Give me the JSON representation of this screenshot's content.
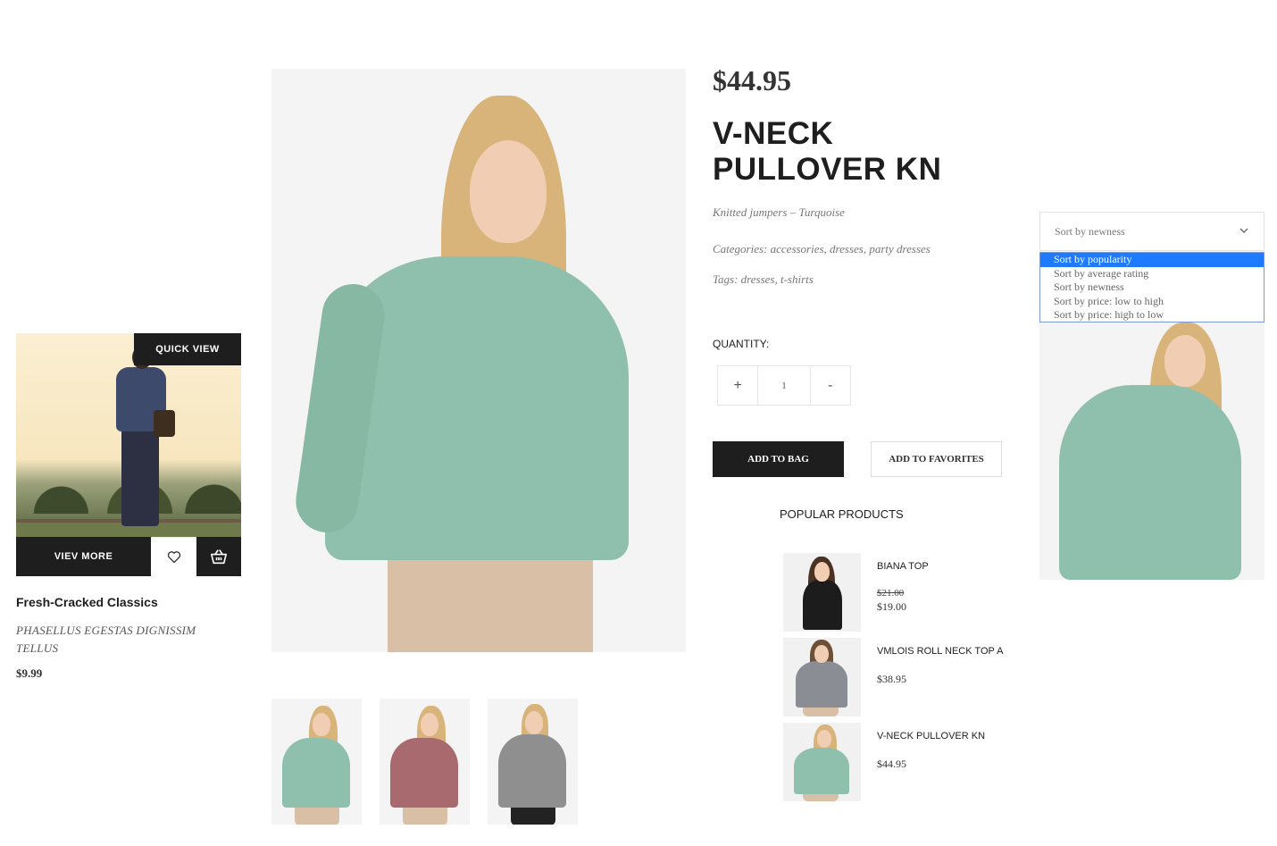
{
  "product_card": {
    "quick_view_label": "QUICK VIEW",
    "view_more_label": "VIEV MORE",
    "title": "Fresh-Cracked Classics",
    "subtitle": "PHASELLUS EGESTAS DIGNISSIM TELLUS",
    "price": "$9.99"
  },
  "product": {
    "price": "$44.95",
    "title": "V-NECK PULLOVER KN",
    "subtitle": "Knitted jumpers – Turquoise",
    "categories": "Categories: accessories, dresses, party dresses",
    "tags": "Tags: dresses, t-shirts",
    "quantity_label": "QUANTITY:",
    "quantity_plus": "+",
    "quantity_value": "1",
    "quantity_minus": "-",
    "add_to_bag_label": "ADD TO BAG",
    "add_to_favorites_label": "ADD TO FAVORITES",
    "thumbnail_colors": [
      "#8fc0ad",
      "#a86a6e",
      "#8f8f8f"
    ]
  },
  "popular": {
    "title": "POPULAR PRODUCTS",
    "items": [
      {
        "name": "BIANA TOP",
        "old_price": "$21.00",
        "price": "$19.00",
        "color": "#1c1c1c"
      },
      {
        "name": "VMLOIS ROLL NECK TOP A",
        "old_price": "",
        "price": "$38.95",
        "color": "#8a8d93"
      },
      {
        "name": "V-NECK PULLOVER KN",
        "old_price": "",
        "price": "$44.95",
        "color": "#8fc0ad"
      }
    ]
  },
  "sort": {
    "selected": "Sort by newness",
    "highlighted": "Sort by popularity",
    "options": [
      "Sort by popularity",
      "Sort by average rating",
      "Sort by newness",
      "Sort by price: low to high",
      "Sort by price: high to low"
    ]
  },
  "colors": {
    "dark": "#1e1e1e",
    "sweater": "#8fc0ad",
    "select_highlight": "#1e7bff"
  }
}
